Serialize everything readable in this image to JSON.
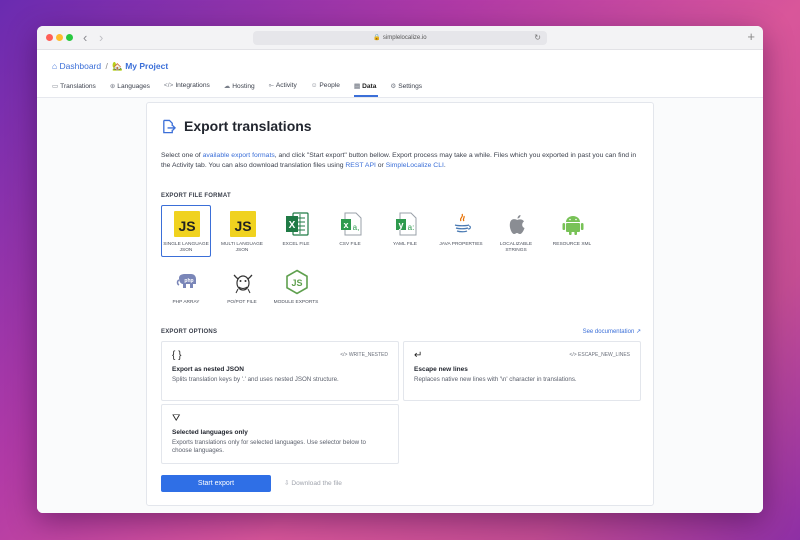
{
  "browser": {
    "url": "simplelocalize.io"
  },
  "breadcrumb": {
    "dashboard": "Dashboard",
    "separator": "/",
    "project": "My Project",
    "project_emoji": "🏡"
  },
  "tabs": [
    {
      "label": "Translations",
      "icon": "translations-icon"
    },
    {
      "label": "Languages",
      "icon": "globe-icon"
    },
    {
      "label": "Integrations",
      "icon": "code-icon"
    },
    {
      "label": "Hosting",
      "icon": "cloud-icon"
    },
    {
      "label": "Activity",
      "icon": "activity-icon"
    },
    {
      "label": "People",
      "icon": "people-icon"
    },
    {
      "label": "Data",
      "icon": "database-icon",
      "active": true
    },
    {
      "label": "Settings",
      "icon": "gear-icon"
    }
  ],
  "page": {
    "title": "Export translations",
    "intro_1": "Select one of ",
    "intro_link1": "available export formats",
    "intro_2": ", and click \"Start export\" button bellow. Export process may take a while. Files which you exported in past you can find in the Activity tab. You can also download translation files using ",
    "intro_link2": "REST API",
    "intro_3": " or ",
    "intro_link3": "SimpleLocalize CLI",
    "intro_4": "."
  },
  "formats_label": "EXPORT FILE FORMAT",
  "formats": [
    {
      "label": "Single Language JSON",
      "selected": true
    },
    {
      "label": "Multi Language JSON"
    },
    {
      "label": "Excel File"
    },
    {
      "label": "CSV File"
    },
    {
      "label": "YAML File"
    },
    {
      "label": "Java Properties"
    },
    {
      "label": "Localizable Strings"
    },
    {
      "label": "Resource XML"
    },
    {
      "label": "PHP Array"
    },
    {
      "label": "PO/POT File"
    },
    {
      "label": "Module Exports"
    }
  ],
  "options_label": "EXPORT OPTIONS",
  "see_docs": "See documentation ↗",
  "options": [
    {
      "icon": "{ }",
      "code": "</> WRITE_NESTED",
      "title": "Export as nested JSON",
      "desc": "Splits translation keys by '.' and uses nested JSON structure."
    },
    {
      "icon": "↵",
      "code": "</> ESCAPE_NEW_LINES",
      "title": "Escape new lines",
      "desc": "Replaces native new lines with '\\n' character in translations."
    },
    {
      "icon": "⛛",
      "code": "",
      "title": "Selected languages only",
      "desc": "Exports translations only for selected languages. Use selector below to choose languages."
    }
  ],
  "actions": {
    "start": "Start export",
    "download": "Download the file"
  },
  "colors": {
    "accent": "#3b6fd8",
    "button": "#2f6fe6"
  }
}
